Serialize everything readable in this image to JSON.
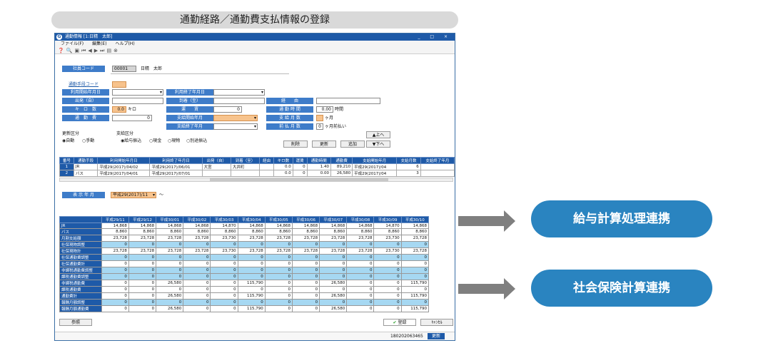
{
  "banner": {
    "title": "通勤経路／通勤費支払情報の登録"
  },
  "window": {
    "title": "通勤情報 [1:日精　太郎]",
    "controls": "_ □ ×",
    "menu": [
      "ファイル(F)",
      "編集(E)",
      "ヘルプ(H)"
    ]
  },
  "form": {
    "employee_code_label": "社員コード",
    "employee_code": "00001",
    "employee_name": "日精　太郎",
    "commute_code_label": "通勤手段コード",
    "start_date_label": "利用開始年月日",
    "end_date_label": "利用終了年月日",
    "departure_label": "出発（自）",
    "arrival_label": "到着（至）",
    "via_label": "経　　由",
    "km_label": "キ　ロ　数",
    "km_value": "0.0",
    "km_unit": "キロ",
    "fare_label": "運　　賃",
    "fare_value": "0",
    "time_label": "通 勤 時 間",
    "time_value": "0.00",
    "time_unit": "時間",
    "cost_label": "通　勤　費",
    "cost_value": "0",
    "pay_start_label": "支給開始年月",
    "pay_months_label": "支 給 月 数",
    "pay_months_unit": "ヶ月",
    "pay_end_label": "支給終了年月",
    "prepay_label": "前 払 月 数",
    "prepay_value": "0",
    "prepay_unit": "ヶ月前払い",
    "update_kbn_label": "更新区分",
    "update_auto": "◉自動",
    "update_manual": "○手動",
    "pay_kbn_label": "支給区分",
    "pay_kbn_options": [
      "◉給与振込",
      "○現金",
      "○現物",
      "○別途振込"
    ],
    "btn_up": "▲上へ",
    "btn_down": "▼下へ",
    "btn_delete": "削除",
    "btn_update": "更新",
    "btn_add": "追加"
  },
  "route_table": {
    "headers": [
      "番号",
      "通勤手段",
      "利用開始年月日",
      "利用終了年月日",
      "出発（自）",
      "到着（至）",
      "経由",
      "キロ数",
      "運賃",
      "通勤時間",
      "通勤費",
      "支給開始年月",
      "支給月数",
      "支給終了年月"
    ],
    "rows": [
      [
        "1",
        "JR",
        "平成29(2017)/04/02",
        "平成29(2017)/06/01",
        "大宮",
        "大井町",
        "",
        "0.0",
        "0",
        "1.40",
        "89,210",
        "平成29(2017)/04",
        "6",
        ""
      ],
      [
        "2",
        "バス",
        "平成29(2017)/04/01",
        "平成29(2017)/07/01",
        "",
        "",
        "",
        "0.0",
        "0",
        "0.00",
        "26,580",
        "平成29(2017)/04",
        "3",
        ""
      ]
    ]
  },
  "display_month": {
    "label": "表 示 年 月",
    "value": "平成29(2017)/11",
    "tilde": "～"
  },
  "monthly_table": {
    "months": [
      "平成29/11",
      "平成29/12",
      "平成30/01",
      "平成30/02",
      "平成30/03",
      "平成30/04",
      "平成30/05",
      "平成30/06",
      "平成30/07",
      "平成30/08",
      "平成30/09",
      "平成30/10"
    ],
    "rows": [
      {
        "name": "JR",
        "hl": false,
        "values": [
          "14,868",
          "14,868",
          "14,868",
          "14,868",
          "14,870",
          "14,868",
          "14,868",
          "14,868",
          "14,868",
          "14,868",
          "14,870",
          "14,868"
        ]
      },
      {
        "name": "バス",
        "hl": false,
        "values": [
          "8,860",
          "8,860",
          "8,860",
          "8,860",
          "8,860",
          "8,860",
          "8,860",
          "8,860",
          "8,860",
          "8,860",
          "8,860",
          "8,860"
        ]
      },
      {
        "name": "月割支給額",
        "hl": false,
        "values": [
          "23,728",
          "23,728",
          "23,728",
          "23,728",
          "23,730",
          "23,728",
          "23,728",
          "23,728",
          "23,728",
          "23,728",
          "23,730",
          "23,728"
        ]
      },
      {
        "name": "社保現物調整",
        "hl": true,
        "values": [
          "0",
          "0",
          "0",
          "0",
          "0",
          "0",
          "0",
          "0",
          "0",
          "0",
          "0",
          "0"
        ]
      },
      {
        "name": "社保現物計",
        "hl": false,
        "values": [
          "23,728",
          "23,728",
          "23,728",
          "23,728",
          "23,730",
          "23,728",
          "23,728",
          "23,728",
          "23,728",
          "23,728",
          "23,730",
          "23,728"
        ]
      },
      {
        "name": "社保通勤費調整",
        "hl": true,
        "values": [
          "0",
          "0",
          "0",
          "0",
          "0",
          "0",
          "0",
          "0",
          "0",
          "0",
          "0",
          "0"
        ]
      },
      {
        "name": "社保通勤費計",
        "hl": false,
        "values": [
          "0",
          "0",
          "0",
          "0",
          "0",
          "0",
          "0",
          "0",
          "0",
          "0",
          "0",
          "0"
        ]
      },
      {
        "name": "非課税通勤費調整",
        "hl": true,
        "values": [
          "0",
          "0",
          "0",
          "0",
          "0",
          "0",
          "0",
          "0",
          "0",
          "0",
          "0",
          "0"
        ]
      },
      {
        "name": "課税通勤費調整",
        "hl": true,
        "values": [
          "0",
          "0",
          "0",
          "0",
          "0",
          "0",
          "0",
          "0",
          "0",
          "0",
          "0",
          "0"
        ]
      },
      {
        "name": "非課税通勤費",
        "hl": false,
        "values": [
          "0",
          "0",
          "26,580",
          "0",
          "0",
          "115,790",
          "0",
          "0",
          "26,580",
          "0",
          "0",
          "115,790"
        ]
      },
      {
        "name": "課税通勤費",
        "hl": false,
        "values": [
          "0",
          "0",
          "0",
          "0",
          "0",
          "0",
          "0",
          "0",
          "0",
          "0",
          "0",
          "0"
        ]
      },
      {
        "name": "通勤費計",
        "hl": false,
        "values": [
          "0",
          "0",
          "26,580",
          "0",
          "0",
          "115,790",
          "0",
          "0",
          "26,580",
          "0",
          "0",
          "115,790"
        ]
      },
      {
        "name": "報酬月額調整",
        "hl": true,
        "values": [
          "0",
          "0",
          "0",
          "0",
          "0",
          "0",
          "0",
          "0",
          "0",
          "0",
          "0",
          "0"
        ]
      },
      {
        "name": "報酬月額通勤費",
        "hl": false,
        "values": [
          "0",
          "0",
          "26,580",
          "0",
          "0",
          "115,790",
          "0",
          "0",
          "26,580",
          "0",
          "0",
          "115,790"
        ]
      }
    ]
  },
  "footer": {
    "ref_btn": "参照",
    "register_btn": "登録",
    "cancel_btn": "ｷｬﾝｾﾙ",
    "status_code": "180202063465",
    "status_update": "更新"
  },
  "callouts": {
    "payroll": "給与計算処理連携",
    "social": "社会保険計算連携"
  },
  "colors": {
    "accent": "#1e5aa8",
    "pill": "#2a84c0",
    "highlight": "#a6d8f2",
    "orange": "#f7c38d"
  }
}
